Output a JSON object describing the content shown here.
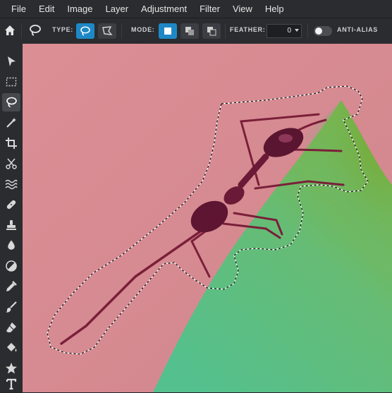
{
  "menu": [
    "File",
    "Edit",
    "Image",
    "Layer",
    "Adjustment",
    "Filter",
    "View",
    "Help"
  ],
  "options_bar": {
    "type_label": "TYPE:",
    "mode_label": "MODE:",
    "feather_label": "FEATHER:",
    "feather_value": "0",
    "anti_alias_label": "ANTI-ALIAS",
    "anti_alias_enabled": false
  },
  "toolbar": {
    "active_tool": "lasso",
    "tools": [
      "move",
      "marquee",
      "lasso",
      "magic-wand",
      "crop",
      "cut",
      "liquify",
      "heal",
      "clone-stamp",
      "blur",
      "dodge-burn",
      "color-picker",
      "brush",
      "eraser",
      "paint-bucket",
      "shape",
      "text"
    ]
  },
  "colors": {
    "accent": "#1e88c6",
    "canvas_background": "#d98c92",
    "leaf": "#6ab86a"
  }
}
